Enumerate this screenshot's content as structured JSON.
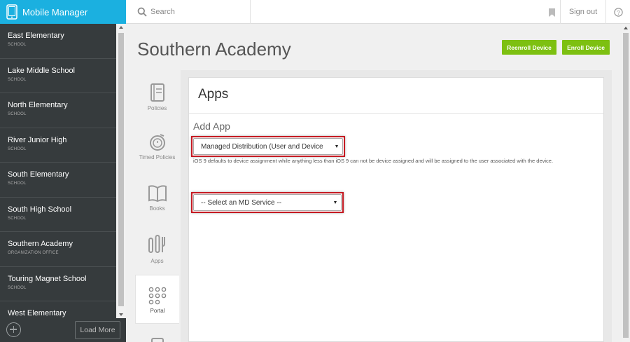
{
  "brand": {
    "title": "Mobile Manager",
    "icon": "phone-icon"
  },
  "topbar": {
    "search_label": "Search",
    "sign_out": "Sign out",
    "bookmark_icon": "bookmark-icon",
    "help_icon": "help-icon"
  },
  "sidebar": {
    "schools": [
      {
        "name": "East Elementary",
        "type": "SCHOOL"
      },
      {
        "name": "Lake Middle School",
        "type": "SCHOOL"
      },
      {
        "name": "North Elementary",
        "type": "SCHOOL"
      },
      {
        "name": "River Junior High",
        "type": "SCHOOL"
      },
      {
        "name": "South Elementary",
        "type": "SCHOOL"
      },
      {
        "name": "South High School",
        "type": "SCHOOL"
      },
      {
        "name": "Southern Academy",
        "type": "ORGANIZATION OFFICE"
      },
      {
        "name": "Touring Magnet School",
        "type": "SCHOOL"
      },
      {
        "name": "West Elementary",
        "type": ""
      }
    ],
    "load_more": "Load More"
  },
  "main": {
    "title": "Southern Academy",
    "reenroll_button": "Reenroll Device",
    "enroll_button": "Enroll Device"
  },
  "tabs": [
    {
      "label": "Policies",
      "icon": "policies-icon"
    },
    {
      "label": "Timed Policies",
      "icon": "timer-icon"
    },
    {
      "label": "Books",
      "icon": "book-icon"
    },
    {
      "label": "Apps",
      "icon": "apps-icon"
    },
    {
      "label": "Portal",
      "icon": "grid-icon"
    }
  ],
  "panel": {
    "title": "Apps",
    "add_app": "Add App",
    "distribution_select": "Managed Distribution (User and Device",
    "helper_text": "iOS 9 defaults to device assignment while anything less than iOS 9 can not be device assigned and will be assigned to the user associated with the device.",
    "md_service_select": "-- Select an MD Service --"
  },
  "colors": {
    "brand": "#1bb0e0",
    "sidebar": "#363b3d",
    "accent_green": "#7dc011",
    "highlight_red": "#c41a22"
  }
}
